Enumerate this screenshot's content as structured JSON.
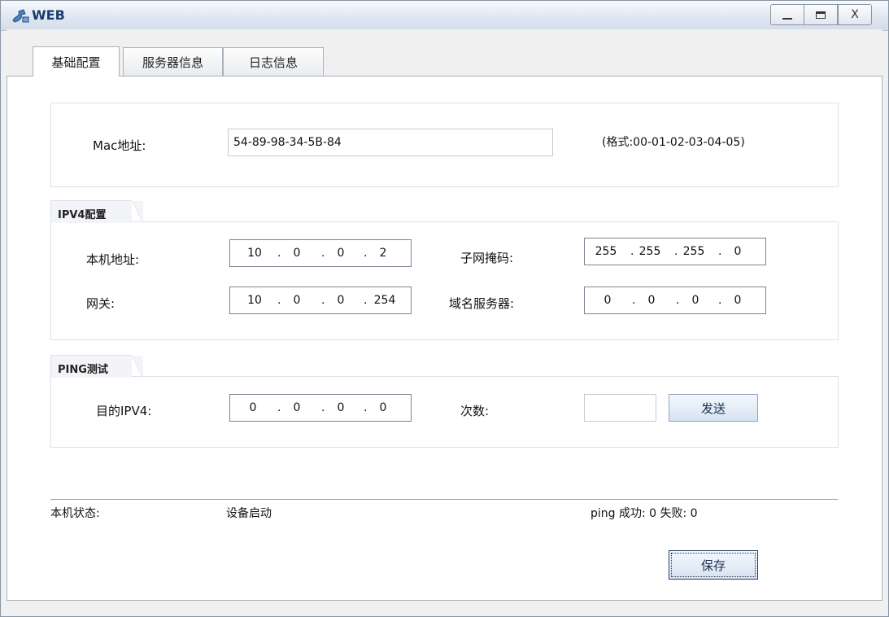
{
  "window": {
    "title": "WEB",
    "min_glyph": "_",
    "close_glyph": "X"
  },
  "tabs": [
    "基础配置",
    "服务器信息",
    "日志信息"
  ],
  "mac": {
    "label": "Mac地址:",
    "value": "54-89-98-34-5B-84",
    "hint": "(格式:00-01-02-03-04-05)"
  },
  "ipv4": {
    "legend": "IPV4配置",
    "local_label": "本机地址:",
    "local": [
      "10",
      "0",
      "0",
      "2"
    ],
    "mask_label": "子网掩码:",
    "mask": [
      "255",
      "255",
      "255",
      "0"
    ],
    "gateway_label": "网关:",
    "gateway": [
      "10",
      "0",
      "0",
      "254"
    ],
    "dns_label": "域名服务器:",
    "dns": [
      "0",
      "0",
      "0",
      "0"
    ]
  },
  "ping": {
    "legend": "PING测试",
    "target_label": "目的IPV4:",
    "target": [
      "0",
      "0",
      "0",
      "0"
    ],
    "count_label": "次数:",
    "count_value": "",
    "send_label": "发送"
  },
  "status": {
    "label": "本机状态:",
    "value": "设备启动",
    "ping_result": "ping 成功: 0 失败: 0"
  },
  "save_label": "保存"
}
